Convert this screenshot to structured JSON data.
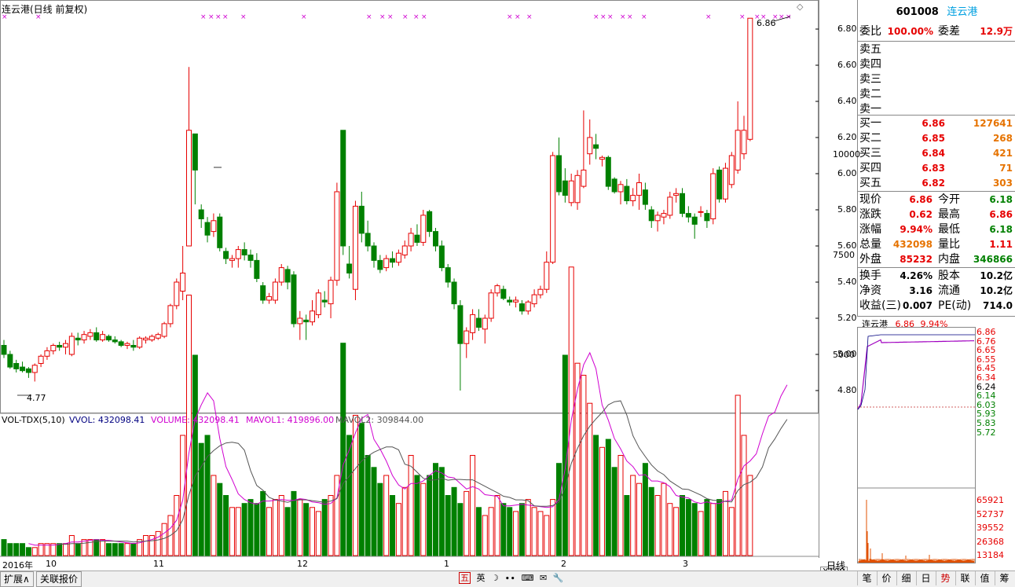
{
  "chart_header": {
    "title": "连云港(日线 前复权)",
    "high_label": "6.86",
    "low_label": "4.77"
  },
  "price_axis": [
    "6.80",
    "6.60",
    "6.40",
    "6.20",
    "6.00",
    "5.80",
    "5.60",
    "5.40",
    "5.20",
    "5.00",
    "4.80"
  ],
  "vol_header": {
    "name": "VOL-TDX(5,10)",
    "vvol": "VVOL: 432098.41",
    "volume": "VOLUME: 432098.41",
    "mavol1": "MAVOL1: 419896.00",
    "mavol2": "MAVOL2: 309844.00"
  },
  "vol_axis": [
    "10000",
    "7500",
    "5000"
  ],
  "vol_unit": "X100",
  "date_axis": [
    "2016年",
    "10",
    "11",
    "12",
    "1",
    "2",
    "3"
  ],
  "period_label": "日线",
  "colors": {
    "up": "#e60000",
    "down": "#008000",
    "ma1": "#d000d0",
    "ma2": "#555555",
    "accent": "#00a0e0"
  },
  "chart_data": {
    "type": "candlestick",
    "series": [
      {
        "o": 5.05,
        "h": 5.08,
        "l": 4.98,
        "c": 5.0
      },
      {
        "o": 5.0,
        "h": 5.02,
        "l": 4.92,
        "c": 4.93
      },
      {
        "o": 4.95,
        "h": 4.97,
        "l": 4.9,
        "c": 4.92
      },
      {
        "o": 4.93,
        "h": 4.96,
        "l": 4.9,
        "c": 4.91
      },
      {
        "o": 4.92,
        "h": 4.93,
        "l": 4.87,
        "c": 4.9
      },
      {
        "o": 4.9,
        "h": 4.95,
        "l": 4.85,
        "c": 4.94
      },
      {
        "o": 4.95,
        "h": 5.0,
        "l": 4.93,
        "c": 4.99
      },
      {
        "o": 4.99,
        "h": 5.04,
        "l": 4.97,
        "c": 5.02
      },
      {
        "o": 5.02,
        "h": 5.06,
        "l": 5.0,
        "c": 5.05
      },
      {
        "o": 5.05,
        "h": 5.07,
        "l": 5.02,
        "c": 5.04
      },
      {
        "o": 5.04,
        "h": 5.08,
        "l": 5.0,
        "c": 5.06
      },
      {
        "o": 5.0,
        "h": 5.12,
        "l": 4.99,
        "c": 5.1
      },
      {
        "o": 5.09,
        "h": 5.12,
        "l": 5.05,
        "c": 5.08
      },
      {
        "o": 5.08,
        "h": 5.13,
        "l": 5.06,
        "c": 5.11
      },
      {
        "o": 5.1,
        "h": 5.14,
        "l": 5.08,
        "c": 5.12
      },
      {
        "o": 5.12,
        "h": 5.15,
        "l": 5.07,
        "c": 5.08
      },
      {
        "o": 5.08,
        "h": 5.13,
        "l": 5.07,
        "c": 5.11
      },
      {
        "o": 5.1,
        "h": 5.11,
        "l": 5.07,
        "c": 5.08
      },
      {
        "o": 5.08,
        "h": 5.1,
        "l": 5.06,
        "c": 5.07
      },
      {
        "o": 5.07,
        "h": 5.08,
        "l": 5.04,
        "c": 5.05
      },
      {
        "o": 5.05,
        "h": 5.07,
        "l": 5.03,
        "c": 5.06
      },
      {
        "o": 5.05,
        "h": 5.08,
        "l": 5.02,
        "c": 5.04
      },
      {
        "o": 5.04,
        "h": 5.1,
        "l": 5.03,
        "c": 5.09
      },
      {
        "o": 5.08,
        "h": 5.1,
        "l": 5.06,
        "c": 5.09
      },
      {
        "o": 5.08,
        "h": 5.11,
        "l": 5.07,
        "c": 5.1
      },
      {
        "o": 5.09,
        "h": 5.12,
        "l": 5.08,
        "c": 5.11
      },
      {
        "o": 5.1,
        "h": 5.18,
        "l": 5.09,
        "c": 5.17
      },
      {
        "o": 5.17,
        "h": 5.28,
        "l": 5.15,
        "c": 5.27
      },
      {
        "o": 5.27,
        "h": 5.42,
        "l": 5.25,
        "c": 5.4
      },
      {
        "o": 5.35,
        "h": 5.6,
        "l": 5.3,
        "c": 5.45
      },
      {
        "o": 5.6,
        "h": 6.59,
        "l": 5.83,
        "c": 6.24
      },
      {
        "o": 6.22,
        "h": 6.22,
        "l": 5.83,
        "c": 6.02
      },
      {
        "o": 5.8,
        "h": 5.83,
        "l": 5.7,
        "c": 5.75
      },
      {
        "o": 5.73,
        "h": 5.76,
        "l": 5.62,
        "c": 5.66
      },
      {
        "o": 5.68,
        "h": 5.78,
        "l": 5.65,
        "c": 5.74
      },
      {
        "o": 5.76,
        "h": 5.78,
        "l": 5.57,
        "c": 5.59
      },
      {
        "o": 5.57,
        "h": 5.59,
        "l": 5.5,
        "c": 5.53
      },
      {
        "o": 5.52,
        "h": 5.55,
        "l": 5.48,
        "c": 5.53
      },
      {
        "o": 5.53,
        "h": 5.6,
        "l": 5.48,
        "c": 5.58
      },
      {
        "o": 5.58,
        "h": 5.62,
        "l": 5.52,
        "c": 5.55
      },
      {
        "o": 5.55,
        "h": 5.58,
        "l": 5.48,
        "c": 5.52
      },
      {
        "o": 5.52,
        "h": 5.56,
        "l": 5.4,
        "c": 5.42
      },
      {
        "o": 5.38,
        "h": 5.4,
        "l": 5.28,
        "c": 5.3
      },
      {
        "o": 5.3,
        "h": 5.34,
        "l": 5.28,
        "c": 5.32
      },
      {
        "o": 5.3,
        "h": 5.42,
        "l": 5.28,
        "c": 5.4
      },
      {
        "o": 5.4,
        "h": 5.5,
        "l": 5.38,
        "c": 5.48
      },
      {
        "o": 5.47,
        "h": 5.49,
        "l": 5.36,
        "c": 5.4
      },
      {
        "o": 5.44,
        "h": 5.46,
        "l": 5.15,
        "c": 5.17
      },
      {
        "o": 5.17,
        "h": 5.24,
        "l": 5.08,
        "c": 5.2
      },
      {
        "o": 5.19,
        "h": 5.22,
        "l": 5.08,
        "c": 5.18
      },
      {
        "o": 5.18,
        "h": 5.3,
        "l": 5.16,
        "c": 5.24
      },
      {
        "o": 5.22,
        "h": 5.36,
        "l": 5.2,
        "c": 5.34
      },
      {
        "o": 5.3,
        "h": 5.35,
        "l": 5.26,
        "c": 5.29
      },
      {
        "o": 5.28,
        "h": 5.43,
        "l": 5.2,
        "c": 5.41
      },
      {
        "o": 5.41,
        "h": 5.95,
        "l": 5.38,
        "c": 5.9
      },
      {
        "o": 6.24,
        "h": 6.24,
        "l": 5.55,
        "c": 5.6
      },
      {
        "o": 5.5,
        "h": 5.6,
        "l": 5.42,
        "c": 5.45
      },
      {
        "o": 5.36,
        "h": 5.85,
        "l": 5.3,
        "c": 5.82
      },
      {
        "o": 5.82,
        "h": 5.9,
        "l": 5.62,
        "c": 5.67
      },
      {
        "o": 5.67,
        "h": 5.74,
        "l": 5.57,
        "c": 5.6
      },
      {
        "o": 5.6,
        "h": 5.62,
        "l": 5.48,
        "c": 5.52
      },
      {
        "o": 5.52,
        "h": 5.55,
        "l": 5.45,
        "c": 5.47
      },
      {
        "o": 5.48,
        "h": 5.55,
        "l": 5.46,
        "c": 5.53
      },
      {
        "o": 5.53,
        "h": 5.57,
        "l": 5.48,
        "c": 5.51
      },
      {
        "o": 5.51,
        "h": 5.58,
        "l": 5.49,
        "c": 5.56
      },
      {
        "o": 5.55,
        "h": 5.63,
        "l": 5.53,
        "c": 5.6
      },
      {
        "o": 5.6,
        "h": 5.7,
        "l": 5.57,
        "c": 5.67
      },
      {
        "o": 5.66,
        "h": 5.72,
        "l": 5.6,
        "c": 5.62
      },
      {
        "o": 5.62,
        "h": 5.8,
        "l": 5.6,
        "c": 5.77
      },
      {
        "o": 5.79,
        "h": 5.8,
        "l": 5.65,
        "c": 5.68
      },
      {
        "o": 5.68,
        "h": 5.7,
        "l": 5.57,
        "c": 5.6
      },
      {
        "o": 5.6,
        "h": 5.63,
        "l": 5.46,
        "c": 5.48
      },
      {
        "o": 5.48,
        "h": 5.5,
        "l": 5.37,
        "c": 5.4
      },
      {
        "o": 5.4,
        "h": 5.42,
        "l": 5.25,
        "c": 5.28
      },
      {
        "o": 5.27,
        "h": 5.3,
        "l": 4.8,
        "c": 5.06
      },
      {
        "o": 5.06,
        "h": 5.15,
        "l": 4.98,
        "c": 5.13
      },
      {
        "o": 5.12,
        "h": 5.25,
        "l": 5.08,
        "c": 5.22
      },
      {
        "o": 5.2,
        "h": 5.25,
        "l": 5.13,
        "c": 5.15
      },
      {
        "o": 5.14,
        "h": 5.22,
        "l": 5.06,
        "c": 5.2
      },
      {
        "o": 5.2,
        "h": 5.36,
        "l": 5.18,
        "c": 5.34
      },
      {
        "o": 5.34,
        "h": 5.39,
        "l": 5.32,
        "c": 5.38
      },
      {
        "o": 5.36,
        "h": 5.38,
        "l": 5.3,
        "c": 5.31
      },
      {
        "o": 5.3,
        "h": 5.32,
        "l": 5.27,
        "c": 5.29
      },
      {
        "o": 5.29,
        "h": 5.32,
        "l": 5.26,
        "c": 5.3
      },
      {
        "o": 5.28,
        "h": 5.3,
        "l": 5.22,
        "c": 5.24
      },
      {
        "o": 5.24,
        "h": 5.3,
        "l": 5.22,
        "c": 5.29
      },
      {
        "o": 5.28,
        "h": 5.36,
        "l": 5.26,
        "c": 5.33
      },
      {
        "o": 5.33,
        "h": 5.38,
        "l": 5.31,
        "c": 5.36
      },
      {
        "o": 5.36,
        "h": 5.57,
        "l": 5.34,
        "c": 5.51
      },
      {
        "o": 5.51,
        "h": 6.12,
        "l": 5.5,
        "c": 6.1
      },
      {
        "o": 6.1,
        "h": 6.2,
        "l": 5.88,
        "c": 5.9
      },
      {
        "o": 5.96,
        "h": 6.03,
        "l": 5.84,
        "c": 5.88
      },
      {
        "o": 5.84,
        "h": 6.0,
        "l": 5.82,
        "c": 5.96
      },
      {
        "o": 5.84,
        "h": 6.02,
        "l": 5.8,
        "c": 5.99
      },
      {
        "o": 5.93,
        "h": 6.35,
        "l": 5.92,
        "c": 6.02
      },
      {
        "o": 6.11,
        "h": 6.3,
        "l": 6.05,
        "c": 6.2
      },
      {
        "o": 6.16,
        "h": 6.22,
        "l": 6.08,
        "c": 6.14
      },
      {
        "o": 6.08,
        "h": 6.1,
        "l": 6.04,
        "c": 6.09
      },
      {
        "o": 6.09,
        "h": 6.1,
        "l": 5.91,
        "c": 5.93
      },
      {
        "o": 5.97,
        "h": 5.98,
        "l": 5.89,
        "c": 5.9
      },
      {
        "o": 5.9,
        "h": 5.96,
        "l": 5.83,
        "c": 5.94
      },
      {
        "o": 5.93,
        "h": 5.97,
        "l": 5.83,
        "c": 5.85
      },
      {
        "o": 5.85,
        "h": 5.92,
        "l": 5.82,
        "c": 5.88
      },
      {
        "o": 5.88,
        "h": 6.0,
        "l": 5.8,
        "c": 5.95
      },
      {
        "o": 5.91,
        "h": 5.95,
        "l": 5.8,
        "c": 5.83
      },
      {
        "o": 5.8,
        "h": 5.82,
        "l": 5.7,
        "c": 5.74
      },
      {
        "o": 5.74,
        "h": 5.79,
        "l": 5.68,
        "c": 5.77
      },
      {
        "o": 5.76,
        "h": 5.8,
        "l": 5.72,
        "c": 5.78
      },
      {
        "o": 5.77,
        "h": 5.9,
        "l": 5.75,
        "c": 5.87
      },
      {
        "o": 5.88,
        "h": 5.92,
        "l": 5.84,
        "c": 5.89
      },
      {
        "o": 5.89,
        "h": 5.92,
        "l": 5.76,
        "c": 5.78
      },
      {
        "o": 5.78,
        "h": 5.82,
        "l": 5.73,
        "c": 5.76
      },
      {
        "o": 5.76,
        "h": 5.78,
        "l": 5.64,
        "c": 5.72
      },
      {
        "o": 5.79,
        "h": 5.82,
        "l": 5.76,
        "c": 5.79
      },
      {
        "o": 5.78,
        "h": 5.8,
        "l": 5.7,
        "c": 5.74
      },
      {
        "o": 5.75,
        "h": 6.03,
        "l": 5.72,
        "c": 6.0
      },
      {
        "o": 6.02,
        "h": 6.04,
        "l": 5.84,
        "c": 5.86
      },
      {
        "o": 5.86,
        "h": 6.06,
        "l": 5.84,
        "c": 6.03
      },
      {
        "o": 5.94,
        "h": 6.12,
        "l": 5.92,
        "c": 6.1
      },
      {
        "o": 6.02,
        "h": 6.4,
        "l": 6.0,
        "c": 6.24
      },
      {
        "o": 6.11,
        "h": 6.32,
        "l": 6.08,
        "c": 6.24
      },
      {
        "o": 6.19,
        "h": 6.86,
        "l": 6.18,
        "c": 6.86
      }
    ],
    "volume": [
      4,
      3,
      3,
      3,
      2,
      2,
      3,
      3,
      3,
      3,
      3,
      5,
      3,
      4,
      4,
      4,
      4,
      3,
      3,
      3,
      3,
      3,
      4,
      5,
      5,
      6,
      8,
      10,
      15,
      30,
      65,
      50,
      28,
      30,
      20,
      18,
      15,
      12,
      12,
      13,
      14,
      13,
      16,
      12,
      14,
      15,
      12,
      16,
      14,
      13,
      12,
      11,
      14,
      15,
      20,
      53,
      30,
      35,
      33,
      25,
      22,
      18,
      20,
      15,
      13,
      17,
      25,
      20,
      18,
      20,
      23,
      22,
      15,
      17,
      13,
      16,
      25,
      12,
      10,
      12,
      15,
      13,
      12,
      11,
      13,
      14,
      12,
      11,
      10,
      14,
      23,
      50,
      72,
      48,
      45,
      38,
      30,
      27,
      29,
      22,
      25,
      15,
      20,
      18,
      23,
      17,
      15,
      18,
      13,
      12,
      15,
      14,
      13,
      11,
      14,
      13,
      14,
      16,
      12,
      40,
      30,
      20,
      25,
      37,
      62,
      35,
      40,
      39
    ]
  },
  "quote": {
    "code": "601008",
    "name": "连云港",
    "wb_label": "委比",
    "wb_val": "100.00%",
    "wc_label": "委差",
    "wc_val": "12.9万",
    "sell": [
      {
        "label": "卖五",
        "price": "",
        "vol": ""
      },
      {
        "label": "卖四",
        "price": "",
        "vol": ""
      },
      {
        "label": "卖三",
        "price": "",
        "vol": ""
      },
      {
        "label": "卖二",
        "price": "",
        "vol": ""
      },
      {
        "label": "卖一",
        "price": "",
        "vol": ""
      }
    ],
    "buy": [
      {
        "label": "买一",
        "price": "6.86",
        "vol": "127641"
      },
      {
        "label": "买二",
        "price": "6.85",
        "vol": "268"
      },
      {
        "label": "买三",
        "price": "6.84",
        "vol": "421"
      },
      {
        "label": "买四",
        "price": "6.83",
        "vol": "71"
      },
      {
        "label": "买五",
        "price": "6.82",
        "vol": "303"
      }
    ],
    "stats": [
      {
        "k1": "现价",
        "v1": "6.86",
        "c1": "#e60000",
        "k2": "今开",
        "v2": "6.18",
        "c2": "#008000"
      },
      {
        "k1": "涨跌",
        "v1": "0.62",
        "c1": "#e60000",
        "k2": "最高",
        "v2": "6.86",
        "c2": "#e60000"
      },
      {
        "k1": "涨幅",
        "v1": "9.94%",
        "c1": "#e60000",
        "k2": "最低",
        "v2": "6.18",
        "c2": "#008000"
      },
      {
        "k1": "总量",
        "v1": "432098",
        "c1": "#e67300",
        "k2": "量比",
        "v2": "1.11",
        "c2": "#e60000"
      },
      {
        "k1": "外盘",
        "v1": "85232",
        "c1": "#e60000",
        "k2": "内盘",
        "v2": "346866",
        "c2": "#008000"
      }
    ],
    "fund": [
      {
        "k1": "换手",
        "v1": "4.26%",
        "k2": "股本",
        "v2": "10.2亿"
      },
      {
        "k1": "净资",
        "v1": "3.16",
        "k2": "流通",
        "v2": "10.2亿"
      },
      {
        "k1": "收益(三)",
        "v1": "0.007",
        "k2": "PE(动)",
        "v2": "714.0"
      }
    ]
  },
  "mini": {
    "name": "连云港",
    "price": "6.86",
    "pct": "9.94%",
    "price_axis": [
      "6.86",
      "6.76",
      "6.65",
      "6.55",
      "6.45",
      "6.34",
      "6.24",
      "6.14",
      "6.03",
      "5.93",
      "5.83",
      "5.72"
    ],
    "vol_axis": [
      "65921",
      "52737",
      "39552",
      "26368",
      "13184"
    ]
  },
  "bottom": {
    "tabs": [
      "扩展∧",
      "关联报价"
    ],
    "right_tabs": [
      "笔",
      "价",
      "细",
      "日",
      "势",
      "联",
      "值",
      "筹"
    ],
    "ime": [
      "五",
      "英",
      "☽",
      "∙∙",
      "⌨",
      "✉",
      "🔧"
    ]
  }
}
